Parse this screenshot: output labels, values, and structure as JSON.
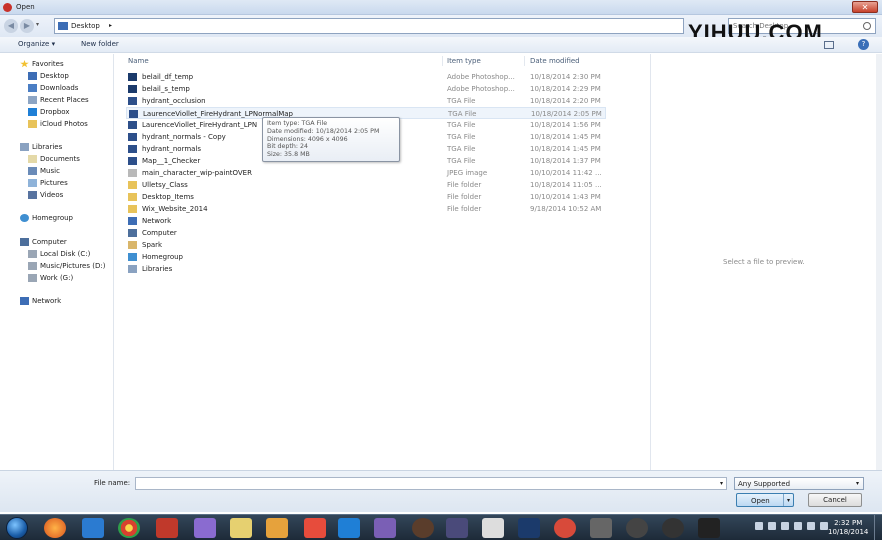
{
  "window": {
    "title": "Open",
    "close_glyph": "✕"
  },
  "address": {
    "location": "Desktop",
    "search_placeholder": "Search Desktop"
  },
  "watermark": {
    "text": "YIHUU.COM"
  },
  "toolbar": {
    "organize_label": "Organize ▾",
    "new_folder_label": "New folder"
  },
  "sidebar": {
    "favorites_label": "Favorites",
    "favorites": [
      "Desktop",
      "Downloads",
      "Recent Places",
      "Dropbox",
      "iCloud Photos"
    ],
    "libraries_label": "Libraries",
    "libraries": [
      "Documents",
      "Music",
      "Pictures",
      "Videos"
    ],
    "homegroup_label": "Homegroup",
    "computer_label": "Computer",
    "drives": [
      "Local Disk (C:)",
      "Music/Pictures (D:)",
      "Work (G:)"
    ],
    "network_label": "Network"
  },
  "columns": {
    "name": "Name",
    "type": "Item type",
    "date": "Date modified"
  },
  "files": [
    {
      "name": "belail_df_temp",
      "type": "Adobe Photoshop...",
      "date": "10/18/2014 2:30 PM",
      "icon": "psd-icon"
    },
    {
      "name": "belail_s_temp",
      "type": "Adobe Photoshop...",
      "date": "10/18/2014 2:29 PM",
      "icon": "psd-icon"
    },
    {
      "name": "hydrant_occlusion",
      "type": "TGA File",
      "date": "10/18/2014 2:20 PM",
      "icon": "tga-icon"
    },
    {
      "name": "LaurenceViollet_FireHydrant_LPNormalMap",
      "type": "TGA File",
      "date": "10/18/2014 2:05 PM",
      "icon": "tga-icon"
    },
    {
      "name": "LaurenceViollet_FireHydrant_LPN",
      "type": "TGA File",
      "date": "10/18/2014 1:56 PM",
      "icon": "tga-icon"
    },
    {
      "name": "hydrant_normals - Copy",
      "type": "TGA File",
      "date": "10/18/2014 1:45 PM",
      "icon": "tga-icon"
    },
    {
      "name": "hydrant_normals",
      "type": "TGA File",
      "date": "10/18/2014 1:45 PM",
      "icon": "tga-icon"
    },
    {
      "name": "Map__1_Checker",
      "type": "TGA File",
      "date": "10/18/2014 1:37 PM",
      "icon": "tga-icon"
    },
    {
      "name": "main_character_wip-paintOVER",
      "type": "JPEG image",
      "date": "10/10/2014 11:42 ...",
      "icon": "jpeg-icon"
    },
    {
      "name": "Ulletsy_Class",
      "type": "File folder",
      "date": "10/18/2014 11:05 ...",
      "icon": "folder-icon"
    },
    {
      "name": "Desktop_Items",
      "type": "File folder",
      "date": "10/10/2014 1:43 PM",
      "icon": "folder-icon"
    },
    {
      "name": "Wix_Website_2014",
      "type": "File folder",
      "date": "9/18/2014 10:52 AM",
      "icon": "folder-icon"
    },
    {
      "name": "Network",
      "type": "",
      "date": "",
      "icon": "network-icon"
    },
    {
      "name": "Computer",
      "type": "",
      "date": "",
      "icon": "computer-icon"
    },
    {
      "name": "Spark",
      "type": "",
      "date": "",
      "icon": "user-folder-icon"
    },
    {
      "name": "Homegroup",
      "type": "",
      "date": "",
      "icon": "homegroup-icon"
    },
    {
      "name": "Libraries",
      "type": "",
      "date": "",
      "icon": "libraries-icon"
    }
  ],
  "tooltip": {
    "lines": [
      "Item type: TGA File",
      "Date modified: 10/18/2014 2:05 PM",
      "Dimensions: 4096 x 4096",
      "Bit depth: 24",
      "Size: 35.8 MB"
    ]
  },
  "preview": {
    "message": "Select a file to preview."
  },
  "bottom": {
    "file_name_label": "File name:",
    "file_name_value": "",
    "file_type_value": "Any Supported",
    "open_label": "Open",
    "cancel_label": "Cancel"
  },
  "taskbar": {
    "time": "2:32 PM",
    "date": "10/18/2014"
  },
  "colors": {
    "folder": "#e8c35a",
    "tga": "#2d4f8a",
    "psd": "#1b3a6b",
    "accent": "#3c7fb1"
  }
}
